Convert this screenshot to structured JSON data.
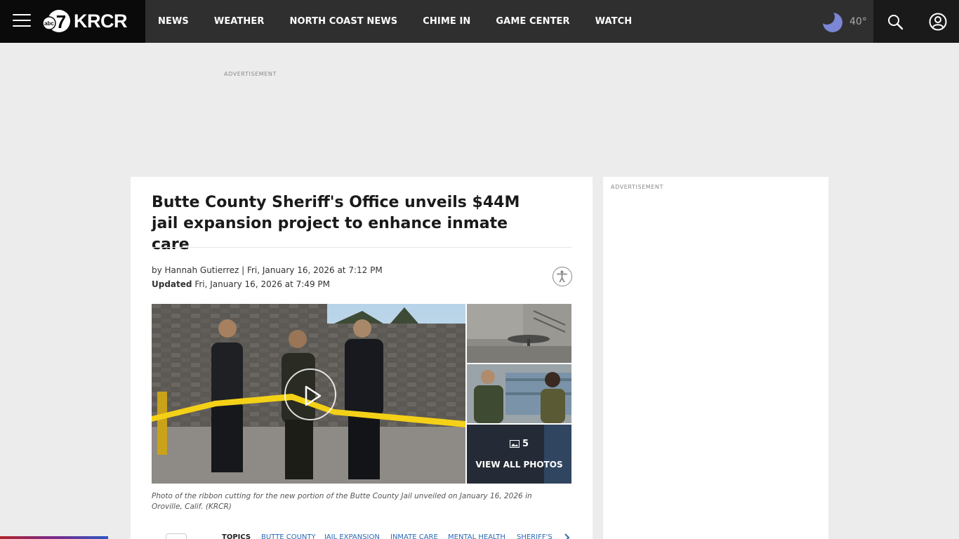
{
  "header": {
    "logo_text": "KRCR",
    "logo_badge": "abc",
    "logo_number": "7",
    "nav": [
      "NEWS",
      "WEATHER",
      "NORTH COAST NEWS",
      "CHIME IN",
      "GAME CENTER",
      "WATCH"
    ],
    "weather_icon": "moon-icon",
    "temperature": "40°"
  },
  "ads": {
    "top_label": "ADVERTISEMENT",
    "side_label": "ADVERTISEMENT"
  },
  "article": {
    "headline": "Butte County Sheriff's Office unveils $44M jail expansion project to enhance inmate care",
    "byline": "by Hannah Gutierrez | Fri, January 16, 2026 at 7:12 PM",
    "updated_label": "Updated",
    "updated_time": " Fri, January 16, 2026 at 7:49 PM",
    "photo_count": "5",
    "view_all": "VIEW ALL PHOTOS",
    "caption": "Photo of the ribbon cutting for the new portion of the Butte County Jail unveiled on January 16, 2026 in Oroville, Calif. (KRCR)",
    "topics_label": "TOPICS",
    "topics": [
      "BUTTE COUNTY",
      "JAIL EXPANSION",
      "INMATE CARE",
      "MENTAL HEALTH",
      "SHERIFF'S"
    ]
  },
  "colors": {
    "header_bg": "#2f2f2f",
    "brand_bg": "#0a0a0a",
    "page_bg": "#ececec",
    "moon": "#7b86d6",
    "link": "#2b6bb5"
  }
}
